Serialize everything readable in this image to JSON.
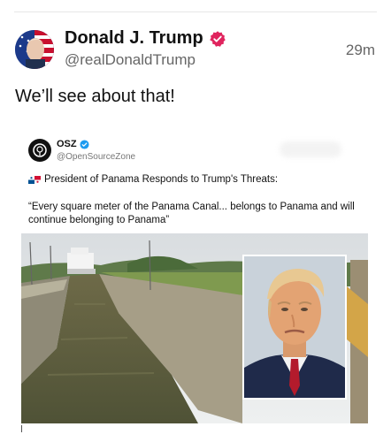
{
  "post": {
    "display_name": "Donald J. Trump",
    "handle": "@realDonaldTrump",
    "timestamp": "29m",
    "text": "We’ll see about that!"
  },
  "quoted": {
    "name": "OSZ",
    "handle": "@OpenSourceZone",
    "headline": "President of Panama Responds to Trump's Threats:",
    "quote": "“Every square meter of the Panama Canal... belongs to Panama and will continue belonging to Panama”"
  },
  "icons": {
    "verified": "verified-badge-icon",
    "quoted_verified": "verified-check-icon",
    "flag": "panama-flag-icon"
  },
  "colors": {
    "verified_badge": "#e0245e",
    "quoted_check": "#1d9bf0",
    "secondary_text": "#666666"
  }
}
